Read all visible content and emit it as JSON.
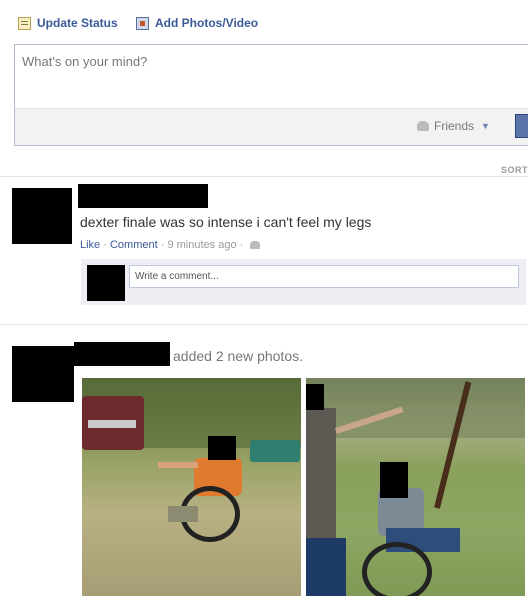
{
  "composer": {
    "tab_status": "Update Status",
    "tab_photo": "Add Photos/Video",
    "placeholder": "What's on your mind?",
    "audience": "Friends"
  },
  "feed": {
    "sort_label": "SORT"
  },
  "post1": {
    "text": "dexter finale was so intense i can't feel my legs",
    "like": "Like",
    "comment": "Comment",
    "time": "9 minutes ago",
    "comment_placeholder": "Write a comment..."
  },
  "post2": {
    "action_text": "added 2 new photos."
  },
  "colors": {
    "link": "#3b5998",
    "comment_bg": "#edeff4",
    "redaction": "#000000"
  },
  "icons": [
    "update-status-icon",
    "add-photo-icon",
    "friends-icon",
    "dropdown-caret-icon"
  ]
}
